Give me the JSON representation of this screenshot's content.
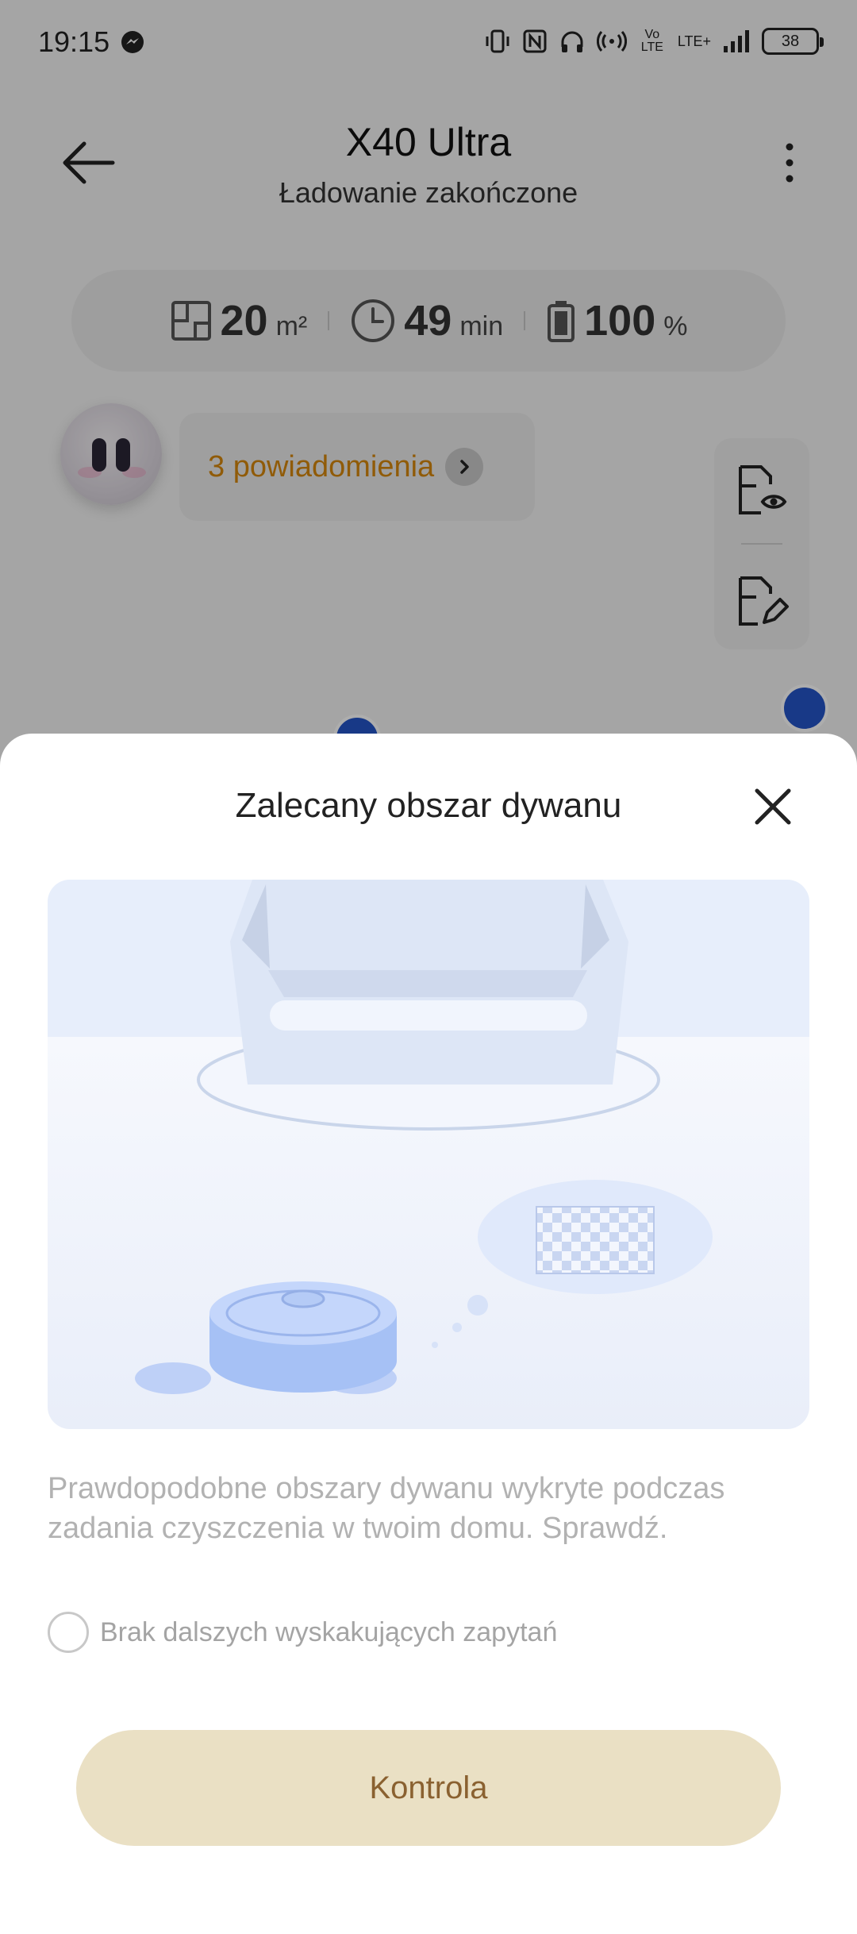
{
  "status_bar": {
    "time": "19:15",
    "network_label": "LTE+",
    "volte_label": "Vo LTE",
    "battery_level": "38"
  },
  "header": {
    "title": "X40 Ultra",
    "subtitle": "Ładowanie zakończone"
  },
  "stats": {
    "area_value": "20",
    "area_unit": "m²",
    "time_value": "49",
    "time_unit": "min",
    "battery_value": "100",
    "battery_unit": "%"
  },
  "notifications": {
    "label": "3 powiadomienia"
  },
  "dialog": {
    "title": "Zalecany obszar dywanu",
    "description": "Prawdopodobne obszary dywanu wykryte podczas zadania czyszczenia w twoim domu. Sprawdź.",
    "checkbox_label": "Brak dalszych wyskakujących zapytań",
    "checkbox_checked": false,
    "button_label": "Kontrola"
  },
  "colors": {
    "accent_orange": "#d5860d",
    "button_bg": "#eae0c4",
    "button_text": "#8a6130",
    "badge_blue": "#2455c8"
  }
}
